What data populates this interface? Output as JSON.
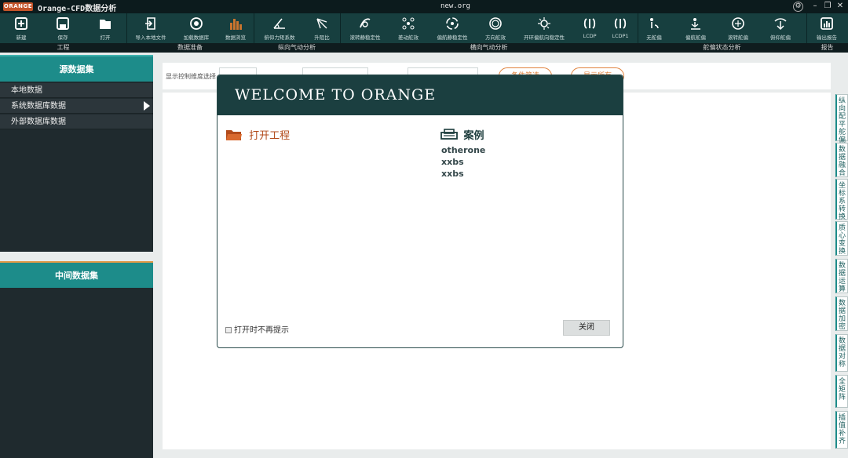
{
  "titlebar": {
    "logo": "ORANGE",
    "app_title": "Orange-CFD数据分析",
    "file_name": "new.org"
  },
  "toolbar": {
    "buttons": [
      {
        "label": "新建",
        "icon": "new-file-icon"
      },
      {
        "label": "保存",
        "icon": "save-icon"
      },
      {
        "label": "打开",
        "icon": "open-folder-icon"
      },
      {
        "label": "导入本地文件",
        "icon": "import-file-icon"
      },
      {
        "label": "加载数据库",
        "icon": "load-database-icon"
      },
      {
        "label": "数据浏览",
        "icon": "bar-chart-icon"
      },
      {
        "label": "俯仰力矩系数",
        "icon": "pitch-angle-icon"
      },
      {
        "label": "升阻比",
        "icon": "lift-drag-icon"
      },
      {
        "label": "滚转静稳定性",
        "icon": "roll-stability-icon"
      },
      {
        "label": "差动舵效",
        "icon": "differential-rudder-icon"
      },
      {
        "label": "偏航静稳定性",
        "icon": "yaw-stability-icon"
      },
      {
        "label": "方向舵效",
        "icon": "rudder-effect-icon"
      },
      {
        "label": "开环偏航向稳定性",
        "icon": "open-loop-yaw-icon"
      },
      {
        "label": "LCDP",
        "icon": "lcdp-icon"
      },
      {
        "label": "LCDP1",
        "icon": "lcdp1-icon"
      },
      {
        "label": "无舵偏",
        "icon": "no-rudder-icon"
      },
      {
        "label": "偏航舵偏",
        "icon": "yaw-rudder-icon"
      },
      {
        "label": "滚转舵偏",
        "icon": "roll-rudder-icon"
      },
      {
        "label": "俯仰舵偏",
        "icon": "pitch-rudder-icon"
      },
      {
        "label": "输出报告",
        "icon": "report-icon"
      }
    ],
    "groups": [
      "工程",
      "数据准备",
      "纵向气动分析",
      "横向气动分析",
      "舵偏状态分析",
      "报告"
    ]
  },
  "left": {
    "source_title": "源数据集",
    "source_items": [
      "本地数据",
      "系统数据库数据",
      "外部数据库数据"
    ],
    "middle_title": "中间数据集"
  },
  "filterbar": {
    "label": "显示控制维度选择",
    "btn1": "条件筛选",
    "btn2": "显示所有"
  },
  "right_tabs": [
    "纵向配平舵偏",
    "数据融合",
    "坐标系转换",
    "质心变换",
    "数据运算",
    "数据加密",
    "数据对称",
    "全矩阵",
    "插值补齐"
  ],
  "dialog": {
    "title": "WELCOME TO ORANGE",
    "open_project": "打开工程",
    "cases_title": "案例",
    "cases": [
      "otherone",
      "xxbs",
      "xxbs"
    ],
    "no_show": "打开时不再提示",
    "close": "关闭"
  }
}
